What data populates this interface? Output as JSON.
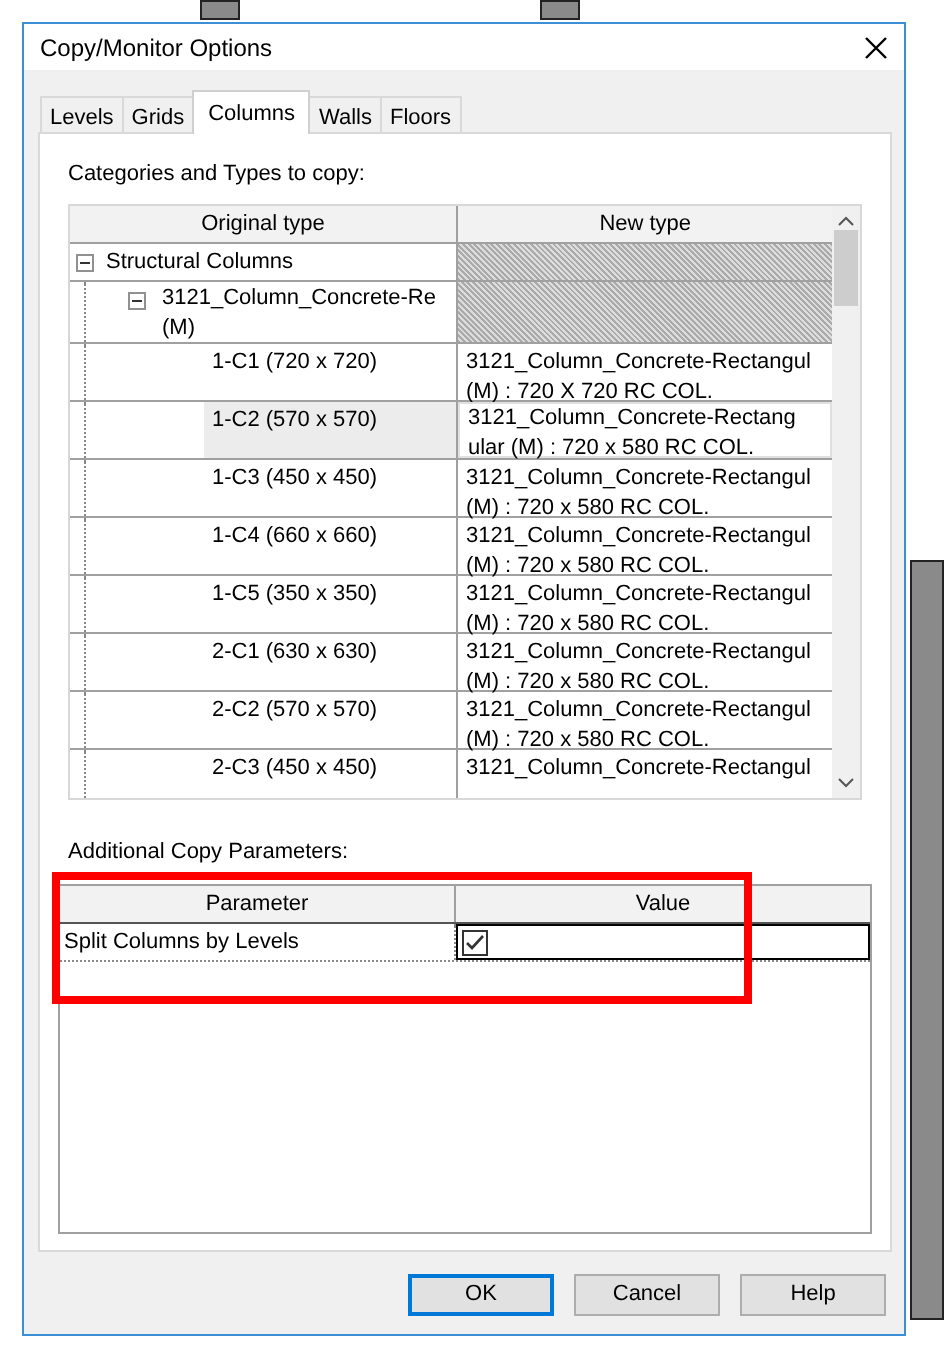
{
  "window": {
    "title": "Copy/Monitor Options"
  },
  "tabs": [
    {
      "label": "Levels",
      "selected": false
    },
    {
      "label": "Grids",
      "selected": false
    },
    {
      "label": "Columns",
      "selected": true
    },
    {
      "label": "Walls",
      "selected": false
    },
    {
      "label": "Floors",
      "selected": false
    }
  ],
  "types_section": {
    "label": "Categories and Types to copy:",
    "columns": [
      "Original type",
      "New type"
    ],
    "tree": [
      {
        "label": "Structural Columns",
        "expanded": true,
        "children": [
          {
            "label_lines": [
              "3121_Column_Concrete-Re",
              "(M)"
            ],
            "expanded": true,
            "children": [
              {
                "label": "1-C1 (720 x 720)",
                "selected": false,
                "new_type_lines": [
                  "3121_Column_Concrete-Rectangul",
                  "(M) : 720 X 720 RC COL."
                ]
              },
              {
                "label": "1-C2 (570 x 570)",
                "selected": true,
                "new_type_lines": [
                  "3121_Column_Concrete-Rectang",
                  "ular (M) : 720 x 580 RC COL."
                ]
              },
              {
                "label": "1-C3 (450 x 450)",
                "selected": false,
                "new_type_lines": [
                  "3121_Column_Concrete-Rectangul",
                  "(M) : 720 x 580 RC COL."
                ]
              },
              {
                "label": "1-C4 (660 x 660)",
                "selected": false,
                "new_type_lines": [
                  "3121_Column_Concrete-Rectangul",
                  "(M) : 720 x 580 RC COL."
                ]
              },
              {
                "label": "1-C5 (350 x 350)",
                "selected": false,
                "new_type_lines": [
                  "3121_Column_Concrete-Rectangul",
                  "(M) : 720 x 580 RC COL."
                ]
              },
              {
                "label": "2-C1 (630 x 630)",
                "selected": false,
                "new_type_lines": [
                  "3121_Column_Concrete-Rectangul",
                  "(M) : 720 x 580 RC COL."
                ]
              },
              {
                "label": "2-C2 (570 x 570)",
                "selected": false,
                "new_type_lines": [
                  "3121_Column_Concrete-Rectangul",
                  "(M) : 720 x 580 RC COL."
                ]
              },
              {
                "label": "2-C3 (450 x 450)",
                "selected": false,
                "new_type_lines": [
                  "3121_Column_Concrete-Rectangul"
                ]
              }
            ]
          }
        ]
      }
    ]
  },
  "parameters_section": {
    "label": "Additional Copy Parameters:",
    "columns": [
      "Parameter",
      "Value"
    ],
    "rows": [
      {
        "parameter": "Split Columns by Levels",
        "checked": true
      }
    ]
  },
  "buttons": [
    {
      "label": "OK",
      "default": true
    },
    {
      "label": "Cancel",
      "default": false
    },
    {
      "label": "Help",
      "default": false
    }
  ]
}
